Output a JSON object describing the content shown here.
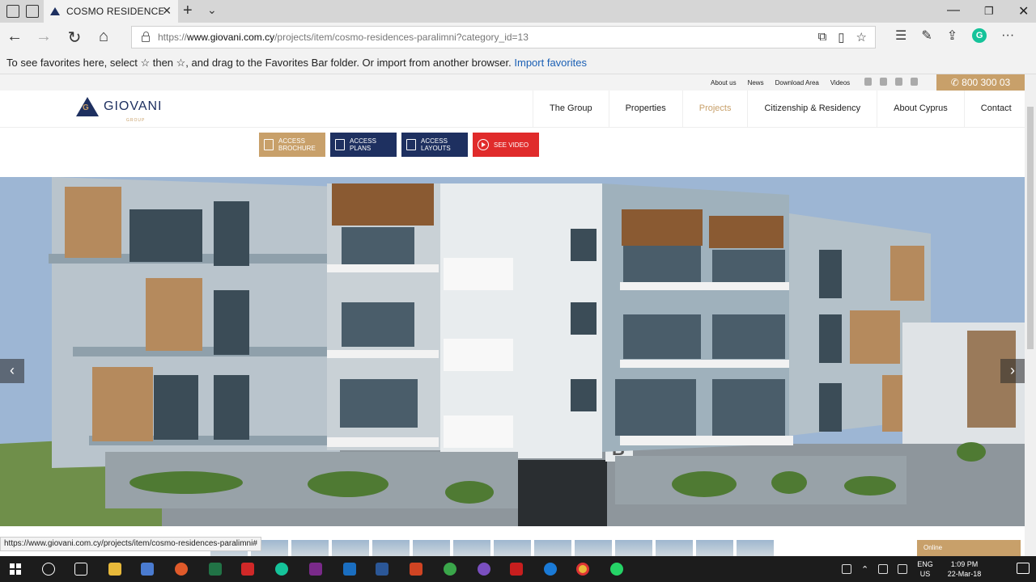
{
  "browser": {
    "tab_title": "COSMO RESIDENCES - I",
    "url_prefix": "https://",
    "url_domain": "www.giovani.com.cy",
    "url_path": "/projects/item/cosmo-residences-paralimni?category_id=13",
    "favorites_text": "To see favorites here, select ☆ then ☆, and drag to the Favorites Bar folder. Or import from another browser.",
    "import_link": "Import favorites",
    "status_url": "https://www.giovani.com.cy/projects/item/cosmo-residences-paralimni#"
  },
  "site": {
    "top_links": [
      "About us",
      "News",
      "Download Area",
      "Videos"
    ],
    "phone": "800 300 03",
    "brand": "GIOVANI",
    "brand_sub": "GROUP",
    "menu": [
      "The Group",
      "Properties",
      "Projects",
      "Citizenship & Residency",
      "About Cyprus",
      "Contact"
    ],
    "active_menu": "Projects",
    "actions": [
      {
        "line1": "ACCESS",
        "line2": "BROCHURE",
        "color": "#c8a06a"
      },
      {
        "line1": "ACCESS",
        "line2": "PLANS",
        "color": "#1e3060"
      },
      {
        "line1": "ACCESS",
        "line2": "LAYOUTS",
        "color": "#1e3060"
      },
      {
        "line1": "SEE VIDEO",
        "line2": "",
        "color": "#e02b2b"
      }
    ],
    "building_letter": "B",
    "prev_arrow": "‹",
    "next_arrow": "›",
    "online_label": "Online",
    "accent_gold": "#c8a06a",
    "accent_navy": "#1e3060",
    "accent_red": "#e02b2b"
  },
  "taskbar": {
    "lang": "ENG",
    "region": "US",
    "time": "1:09 PM",
    "date": "22-Mar-18"
  }
}
